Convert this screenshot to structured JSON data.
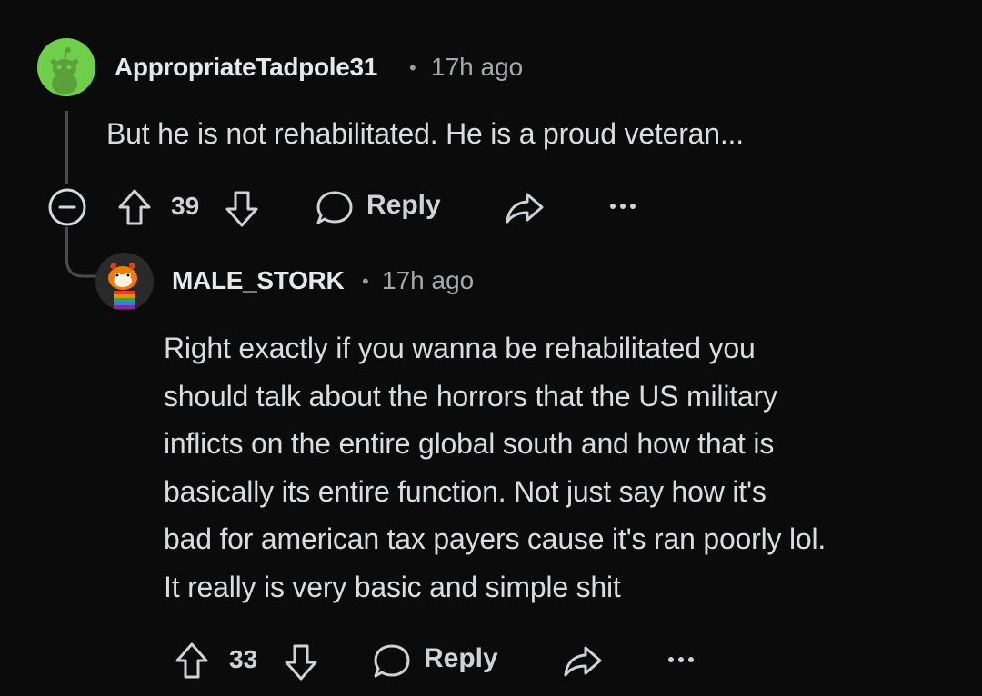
{
  "comment1": {
    "username": "AppropriateTadpole31",
    "separator": "•",
    "time": "17h ago",
    "body": "But he is not rehabilitated. He is a proud veteran...",
    "votes": "39",
    "reply_label": "Reply",
    "avatar_color": "#6fcf4b"
  },
  "comment2": {
    "username": "MALE_STORK",
    "separator": "•",
    "time": "17h ago",
    "body_lines": [
      "Right exactly if you wanna be rehabilitated you",
      "should talk about the horrors that the US military",
      "inflicts on the entire global south and how that is",
      "basically its entire function. Not just say how it's",
      "bad for american tax payers cause it's ran poorly lol.",
      "It really is very basic and simple shit"
    ],
    "votes": "33",
    "reply_label": "Reply"
  },
  "icons": {
    "collapse": "minus-circle-icon",
    "upvote": "arrow-up-icon",
    "downvote": "arrow-down-icon",
    "reply": "speech-bubble-icon",
    "share": "share-arrow-icon",
    "more": "more-dots-icon"
  }
}
